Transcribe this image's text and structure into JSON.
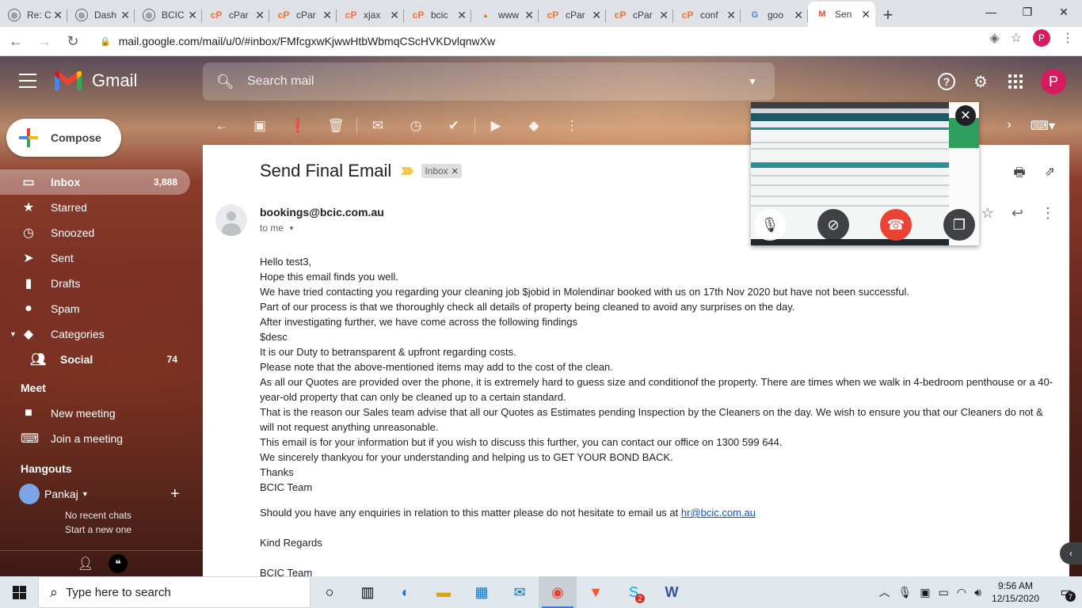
{
  "browser": {
    "tabs": [
      {
        "title": "Re: C",
        "icon": "globe-icon"
      },
      {
        "title": "Dash",
        "icon": "globe-icon"
      },
      {
        "title": "BCIC",
        "icon": "globe-icon"
      },
      {
        "title": "cPar",
        "icon": "cpanel-icon"
      },
      {
        "title": "cPar",
        "icon": "cpanel-icon"
      },
      {
        "title": "xjax",
        "icon": "cpanel-icon"
      },
      {
        "title": "bcic",
        "icon": "cpanel-icon"
      },
      {
        "title": "www",
        "icon": "pma-icon"
      },
      {
        "title": "cPar",
        "icon": "cpanel-icon"
      },
      {
        "title": "cPar",
        "icon": "cpanel-icon"
      },
      {
        "title": "conf",
        "icon": "cpanel-icon"
      },
      {
        "title": "goo",
        "icon": "google-icon"
      },
      {
        "title": "Sen",
        "icon": "gmail-icon",
        "active": true
      }
    ],
    "url": "mail.google.com/mail/u/0/#inbox/FMfcgxwKjwwHtbWbmqCScHVKDvlqnwXw",
    "profile_initial": "P"
  },
  "gmail": {
    "logo_text": "Gmail",
    "search_placeholder": "Search mail",
    "account_initial": "P",
    "compose_label": "Compose",
    "nav": [
      {
        "label": "Inbox",
        "count": "3,888",
        "icon": "inbox-icon",
        "active": true
      },
      {
        "label": "Starred",
        "count": "",
        "icon": "star-icon"
      },
      {
        "label": "Snoozed",
        "count": "",
        "icon": "clock-icon"
      },
      {
        "label": "Sent",
        "count": "",
        "icon": "send-icon"
      },
      {
        "label": "Drafts",
        "count": "",
        "icon": "draft-icon"
      },
      {
        "label": "Spam",
        "count": "",
        "icon": "spam-icon"
      },
      {
        "label": "Categories",
        "count": "",
        "icon": "label-icon"
      },
      {
        "label": "Social",
        "count": "74",
        "icon": "people-icon"
      }
    ],
    "meet": {
      "title": "Meet",
      "new_meeting": "New meeting",
      "join_meeting": "Join a meeting"
    },
    "hangouts": {
      "title": "Hangouts",
      "user": "Pankaj",
      "no_chats": "No recent chats",
      "start_new": "Start a new one"
    }
  },
  "email": {
    "subject": "Send Final Email",
    "label": "Inbox",
    "sender": "bookings@bcic.com.au",
    "to": "to me",
    "lines": [
      "Hello test3,",
      "Hope this email finds you well.",
      "We have tried contacting you regarding your cleaning job $jobid in Molendinar booked with us on 17th Nov 2020 but have not been successful.",
      "Part of our process is that we thoroughly check all details of property being cleaned to avoid any surprises on the day.",
      "After investigating further, we have come across the following findings",
      "$desc",
      "It is our Duty to betransparent & upfront regarding costs.",
      "Please note that the above-mentioned items may add to the cost of the clean.",
      "As all our Quotes are provided over the phone, it is extremely hard to guess size and conditionof the property. There are times when we walk in 4-bedroom penthouse or a 40-year-old property that can only be cleaned up to a certain standard.",
      "That is the reason our Sales team advise that all our Quotes as Estimates pending Inspection by the Cleaners on the day. We wish to ensure you that our Cleaners do not & will not request anything unreasonable.",
      "This email is for your information but if you wish to discuss this further, you can contact our office on 1300 599 644.",
      "We sincerely thankyou for your understanding and helping us to GET YOUR BOND BACK.",
      "Thanks",
      "BCIC Team"
    ],
    "enquiry_text": "Should you have any enquiries in relation to this matter please do not hesitate to email us at ",
    "enquiry_link": "hr@bcic.com.au",
    "regards": "Kind Regards",
    "signoff": "BCIC Team"
  },
  "taskbar": {
    "search_placeholder": "Type here to search",
    "time": "9:56 AM",
    "date": "12/15/2020",
    "notification_count": "7",
    "skype_badge": "2"
  }
}
